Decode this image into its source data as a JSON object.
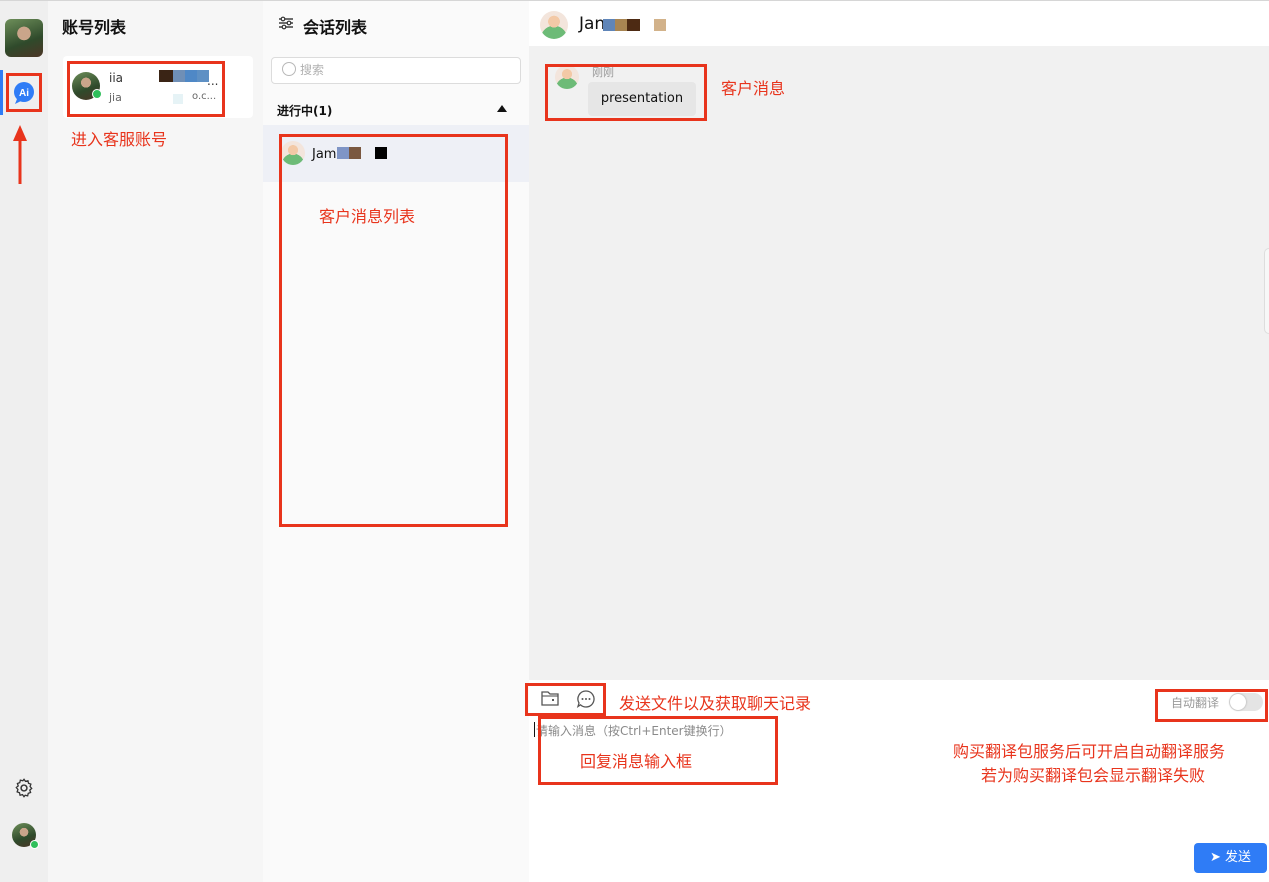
{
  "account_panel": {
    "title": "账号列表",
    "account": {
      "name": "iia",
      "sub": "jia",
      "sub_suffix": "o.c...",
      "ellipsis": "..."
    }
  },
  "conversation_panel": {
    "title": "会话列表",
    "search": {
      "placeholder": "搜索"
    },
    "group": {
      "label": "进行中(1)"
    },
    "items": [
      {
        "name": "Jam"
      }
    ]
  },
  "chat": {
    "header_name": "Jan",
    "message": {
      "sender": "刚刚",
      "text": "presentation"
    },
    "composer": {
      "placeholder": "请输入消息（按Ctrl+Enter键换行）",
      "auto_translate_label": "自动翻译",
      "auto_translate_on": false,
      "send_label": "发送"
    }
  },
  "annotations": {
    "enter_account": "进入客服账号",
    "message_list": "客户消息列表",
    "customer_message": "客户消息",
    "file_and_history": "发送文件以及获取聊天记录",
    "reply_box": "回复消息输入框",
    "translate_line1": "购买翻译包服务后可开启自动翻译服务",
    "translate_line2": "若为购买翻译包会显示翻译失败"
  },
  "colors": {
    "accent": "#2f7cf6",
    "annotation": "#e8341c",
    "online": "#2fbf5a"
  },
  "icons": [
    "ai-chat-icon",
    "gear-icon",
    "filter-icon",
    "search-icon",
    "caret-up-icon",
    "folder-icon",
    "chat-history-icon",
    "send-icon",
    "arrow-up-icon"
  ]
}
